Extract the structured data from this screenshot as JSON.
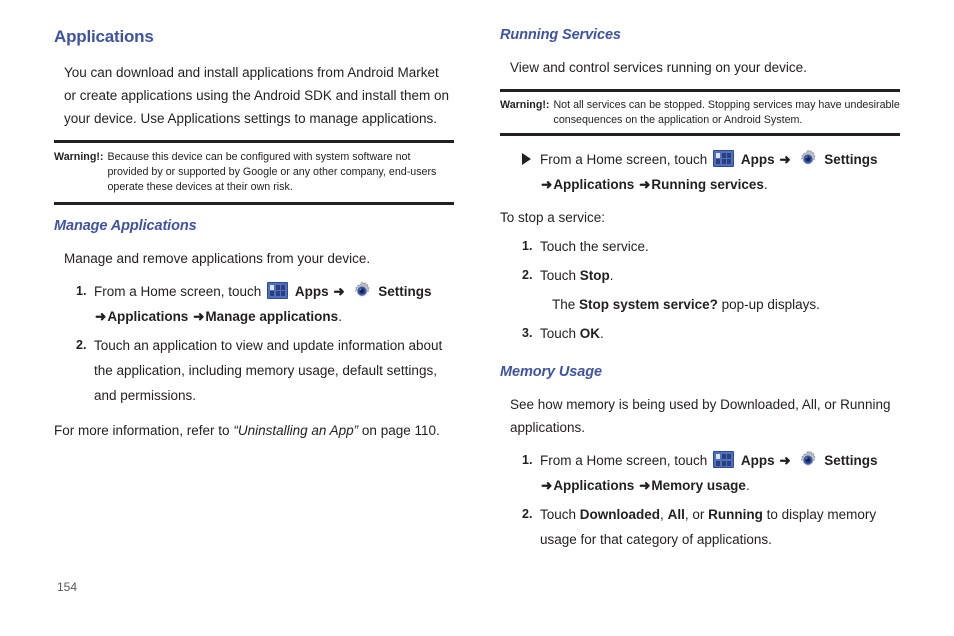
{
  "page": {
    "number": "154"
  },
  "icons": {
    "apps": "apps-grid-icon",
    "settings": "settings-gear-icon",
    "arrow": "➜",
    "bullet": "triangle-bullet-icon"
  },
  "left_column": {
    "heading": "Applications",
    "intro": "You can download and install applications from Android Market or create applications using the Android SDK and install them on your device. Use Applications settings to manage applications.",
    "warning": {
      "label": "Warning!:",
      "text": "Because this device can be configured with system software not provided by or supported by Google or any other company, end-users operate these devices at their own risk."
    },
    "subsection": {
      "heading": "Manage Applications",
      "intro": "Manage and remove applications from your device.",
      "steps": [
        {
          "num": "1.",
          "text_before_apps": "From a Home screen, touch",
          "apps_label": "Apps",
          "settings_label": "Settings",
          "path_line": "Applications",
          "path_target": "Manage applications",
          "path_end": "."
        },
        {
          "num": "2.",
          "text": "Touch an application to view and update information about the application, including memory usage, default settings, and permissions."
        }
      ],
      "note_before": "For more information, refer to",
      "note_ref": "“Uninstalling an App”",
      "note_after": "on page 110."
    }
  },
  "right_column": {
    "running_services": {
      "heading": "Running Services",
      "intro": "View and control services running on your device.",
      "warning": {
        "label": "Warning!:",
        "text": "Not all services can be stopped. Stopping services may have undesirable consequences on the application or Android System."
      },
      "nav_step": {
        "text_before_apps": "From a Home screen, touch",
        "apps_label": "Apps",
        "settings_label": "Settings",
        "path_line": "Applications",
        "path_target": "Running services",
        "path_end": "."
      },
      "stop_intro": "To stop a service:",
      "stop_steps": [
        {
          "num": "1.",
          "text": "Touch the service."
        },
        {
          "num": "2.",
          "text_before": "Touch",
          "bold": "Stop",
          "text_after": "."
        },
        {
          "sub_before": "The",
          "sub_bold": "Stop system service?",
          "sub_after": "pop-up displays."
        },
        {
          "num": "3.",
          "text_before": "Touch",
          "bold": "OK",
          "text_after": "."
        }
      ]
    },
    "memory_usage": {
      "heading": "Memory Usage",
      "intro": "See how memory is being used by Downloaded, All, or Running applications.",
      "steps": [
        {
          "num": "1.",
          "text_before_apps": "From a Home screen, touch",
          "apps_label": "Apps",
          "settings_label": "Settings",
          "path_line": "Applications",
          "path_target": "Memory usage",
          "path_end": "."
        },
        {
          "num": "2.",
          "seg1": "Touch",
          "bold1": "Downloaded",
          "seg2": ",",
          "bold2": "All",
          "seg3": ", or",
          "bold3": "Running",
          "seg4": "to display memory usage for that category of applications."
        }
      ]
    }
  },
  "colors": {
    "heading_blue": "#3e54a3",
    "body_black": "#231f20",
    "apps_icon_blue": "#4f6fbf",
    "folio_gray": "#58595b"
  }
}
